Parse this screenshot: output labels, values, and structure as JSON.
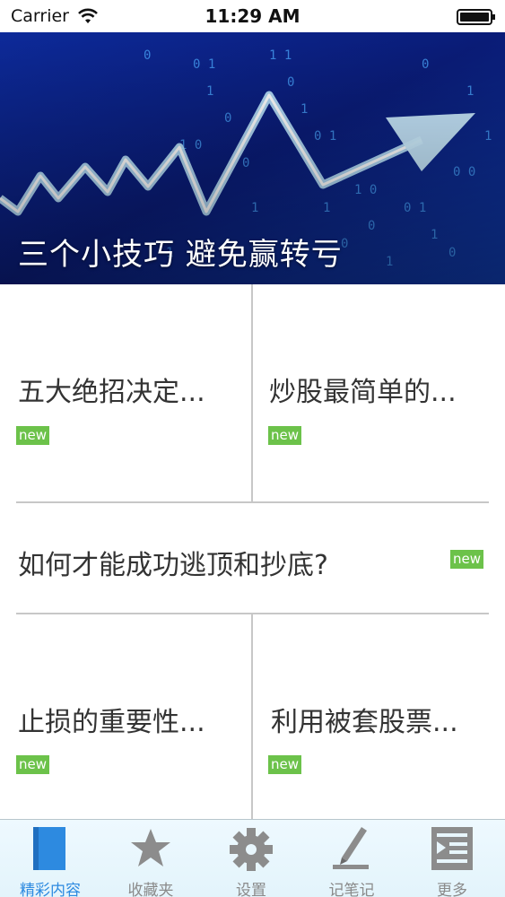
{
  "status_bar": {
    "carrier": "Carrier",
    "time": "11:29 AM"
  },
  "banner": {
    "title": "三个小技巧 避免赢转亏"
  },
  "articles": [
    {
      "title": "五大绝招决定...",
      "badge": "new"
    },
    {
      "title": "炒股最简单的...",
      "badge": "new"
    },
    {
      "title": "如何才能成功逃顶和抄底?",
      "badge": "new"
    },
    {
      "title": "止损的重要性...",
      "badge": "new"
    },
    {
      "title": "利用被套股票...",
      "badge": "new"
    }
  ],
  "tabs": [
    {
      "label": "精彩内容",
      "icon": "book-icon",
      "active": true
    },
    {
      "label": "收藏夹",
      "icon": "star-icon"
    },
    {
      "label": "设置",
      "icon": "gear-icon"
    },
    {
      "label": "记笔记",
      "icon": "pen-icon"
    },
    {
      "label": "更多",
      "icon": "more-list-icon"
    }
  ],
  "colors": {
    "badge": "#6cc24a",
    "tab_active": "#2d8ae0",
    "tab_inactive": "#8a8a8a",
    "banner_bg": "#0a1e7a"
  }
}
